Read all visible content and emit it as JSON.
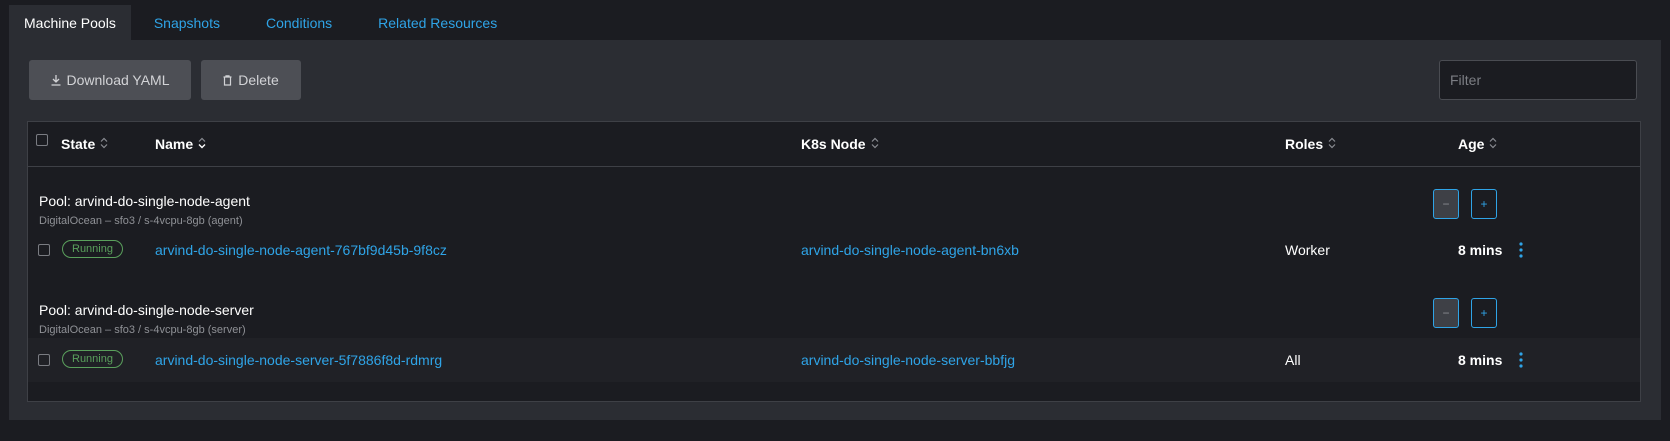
{
  "tabs": [
    {
      "label": "Machine Pools",
      "active": true
    },
    {
      "label": "Snapshots",
      "active": false
    },
    {
      "label": "Conditions",
      "active": false
    },
    {
      "label": "Related Resources",
      "active": false
    }
  ],
  "toolbar": {
    "download_label": "Download YAML",
    "delete_label": "Delete",
    "filter_placeholder": "Filter"
  },
  "table": {
    "headers": {
      "state": "State",
      "name": "Name",
      "k8s_node": "K8s Node",
      "roles": "Roles",
      "age": "Age"
    },
    "groups": [
      {
        "pool_title": "Pool: arvind-do-single-node-agent",
        "pool_subtitle": "DigitalOcean – sfo3 / s-4vcpu-8gb (agent)",
        "rows": [
          {
            "state": "Running",
            "name": "arvind-do-single-node-agent-767bf9d45b-9f8cz",
            "k8s_node": "arvind-do-single-node-agent-bn6xb",
            "roles": "Worker",
            "age": "8 mins"
          }
        ]
      },
      {
        "pool_title": "Pool: arvind-do-single-node-server",
        "pool_subtitle": "DigitalOcean – sfo3 / s-4vcpu-8gb (server)",
        "rows": [
          {
            "state": "Running",
            "name": "arvind-do-single-node-server-5f7886f8d-rdmrg",
            "k8s_node": "arvind-do-single-node-server-bbfjg",
            "roles": "All",
            "age": "8 mins"
          }
        ]
      }
    ]
  },
  "colors": {
    "accent": "#2fa4e7",
    "running": "#5aa05c",
    "background": "#1b1c21",
    "panel": "#2b2d33"
  },
  "icons": [
    "download-icon",
    "trash-icon",
    "sort-icon",
    "minus-icon",
    "plus-icon",
    "kebab-menu-icon"
  ]
}
